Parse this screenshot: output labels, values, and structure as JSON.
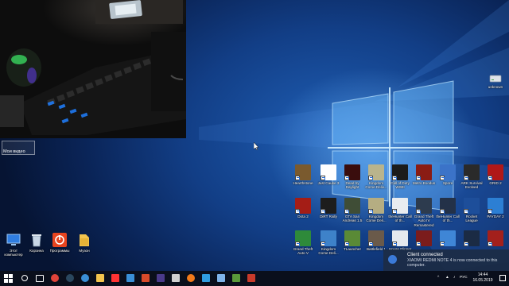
{
  "video_window": {
    "label": "Мои видео"
  },
  "left_icons": [
    {
      "id": "this-pc",
      "label": "Этот компьютер",
      "color": "#2f7de1"
    },
    {
      "id": "recycle-bin",
      "label": "Корзина",
      "color": "#c8d6e6"
    },
    {
      "id": "programs",
      "label": "Программы",
      "color": "#e8441f"
    },
    {
      "id": "music",
      "label": "Музон",
      "color": "#f3c44d"
    }
  ],
  "unknown_icon": {
    "label": "unknown",
    "color": "#dfe4ea"
  },
  "game_icons_row1": [
    {
      "label": "Hearthstone",
      "color": "#7a5a2e"
    },
    {
      "label": "Just Cause 3",
      "color": "#ffffff"
    },
    {
      "label": "Dead by Daylight",
      "color": "#3a0d0d"
    },
    {
      "label": "Kingdom Come Deliv...",
      "color": "#b9b48c"
    },
    {
      "label": "Call of Duty WWII",
      "color": "#1c1c1c"
    },
    {
      "label": "Metro Exodus",
      "color": "#8a1c14"
    },
    {
      "label": "Spore",
      "color": "#3b73c8"
    },
    {
      "label": "ARK Survival Evolved",
      "color": "#2a2a2a"
    },
    {
      "label": "GRID 2",
      "color": "#b01818"
    }
  ],
  "game_icons_row2": [
    {
      "label": "Dota 2",
      "color": "#a41d16"
    },
    {
      "label": "DiRT Rally",
      "color": "#1d1d1d"
    },
    {
      "label": "GTA San Andreas 1.5",
      "color": "#3f4d36"
    },
    {
      "label": "Kingdom Come Deli...",
      "color": "#b5ad82"
    },
    {
      "label": "theHunter Call of th...",
      "color": "#e9ecf0"
    },
    {
      "label": "Grand Theft Auto IV Remastered",
      "color": "#2d3b4e"
    },
    {
      "label": "theHunter Call of th...",
      "color": "#233148"
    },
    {
      "label": "Rocket League",
      "color": "#1d4e9a"
    },
    {
      "label": "PAYDAY 2",
      "color": "#2c7fd4"
    }
  ],
  "game_icons_row3": [
    {
      "label": "Grand Theft Auto V",
      "color": "#2e8a3a"
    },
    {
      "label": "Kingdom Come Deli...",
      "color": "#3e82c9"
    },
    {
      "label": "TLauncher",
      "color": "#5a8a36"
    },
    {
      "label": "Battlefield 1",
      "color": "#6a5a4a"
    },
    {
      "label": "House Flipper",
      "color": "#e4e8ee"
    },
    {
      "label": "",
      "color": "#7b1c1c"
    },
    {
      "label": "",
      "color": "#3f86d6"
    },
    {
      "label": "",
      "color": "#1b2b44"
    },
    {
      "label": "",
      "color": "#a3201c"
    }
  ],
  "notification": {
    "title": "Client connected",
    "body": "XIAOMI REDMI NOTE 4 is now connected to this computer."
  },
  "taskbar": {
    "apps": [
      {
        "id": "search",
        "color": "#ffffff"
      },
      {
        "id": "task-view",
        "color": "#ffffff"
      },
      {
        "id": "chrome",
        "color": "#e0443a"
      },
      {
        "id": "steam",
        "color": "#2a475e"
      },
      {
        "id": "uplay",
        "color": "#3a8fd6"
      },
      {
        "id": "explorer",
        "color": "#f3c44d"
      },
      {
        "id": "yandex",
        "color": "#ff3333"
      },
      {
        "id": "store",
        "color": "#3a8fd6"
      },
      {
        "id": "photos",
        "color": "#d84a2a"
      },
      {
        "id": "premiere",
        "color": "#4a3a8a"
      },
      {
        "id": "obs",
        "color": "#cfcfcf"
      },
      {
        "id": "origin",
        "color": "#f27a1a"
      },
      {
        "id": "camera",
        "color": "#2f9de0"
      },
      {
        "id": "notepad",
        "color": "#7fb3e8"
      },
      {
        "id": "minecraft",
        "color": "#5a9a3a"
      },
      {
        "id": "bandicam",
        "color": "#c83a2a"
      }
    ],
    "tray_language": "РУС",
    "time": "14:44",
    "date": "16.05.2019"
  }
}
